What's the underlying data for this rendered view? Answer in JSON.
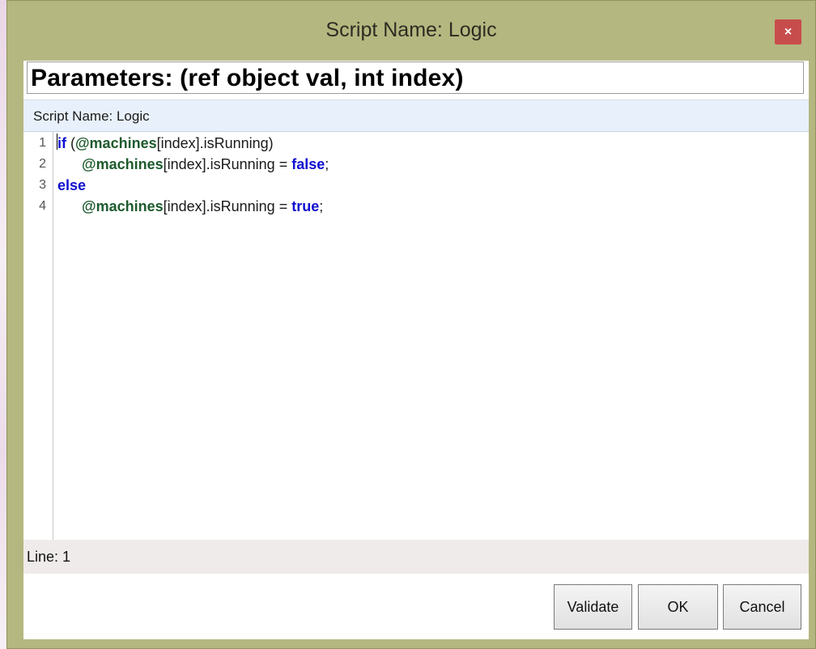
{
  "window": {
    "title": "Script Name: Logic",
    "close_glyph": "×"
  },
  "params": {
    "text": "Parameters: (ref object val, int index)"
  },
  "script_header": {
    "text": "Script Name: Logic"
  },
  "editor": {
    "line_numbers": [
      "1",
      "2",
      "3",
      "4"
    ],
    "lines": [
      [
        {
          "t": "if",
          "c": "kw"
        },
        {
          "t": " (",
          "c": ""
        },
        {
          "t": "@machines",
          "c": "var"
        },
        {
          "t": "[index].isRunning)",
          "c": ""
        }
      ],
      [
        {
          "t": "      ",
          "c": ""
        },
        {
          "t": "@machines",
          "c": "var"
        },
        {
          "t": "[index].isRunning = ",
          "c": ""
        },
        {
          "t": "false",
          "c": "kw"
        },
        {
          "t": ";",
          "c": ""
        }
      ],
      [
        {
          "t": "else",
          "c": "kw"
        }
      ],
      [
        {
          "t": "      ",
          "c": ""
        },
        {
          "t": "@machines",
          "c": "var"
        },
        {
          "t": "[index].isRunning = ",
          "c": ""
        },
        {
          "t": "true",
          "c": "kw"
        },
        {
          "t": ";",
          "c": ""
        }
      ]
    ],
    "colors": {
      "keyword": "#1010d0",
      "variable": "#1e5a2e"
    }
  },
  "status": {
    "text": "Line: 1"
  },
  "buttons": {
    "validate": "Validate",
    "ok": "OK",
    "cancel": "Cancel"
  },
  "colors": {
    "window_frame": "#b5b780",
    "close_button": "#c74d4d",
    "script_header_bg": "#e8f1fb",
    "status_bg": "#f0ebeb"
  }
}
